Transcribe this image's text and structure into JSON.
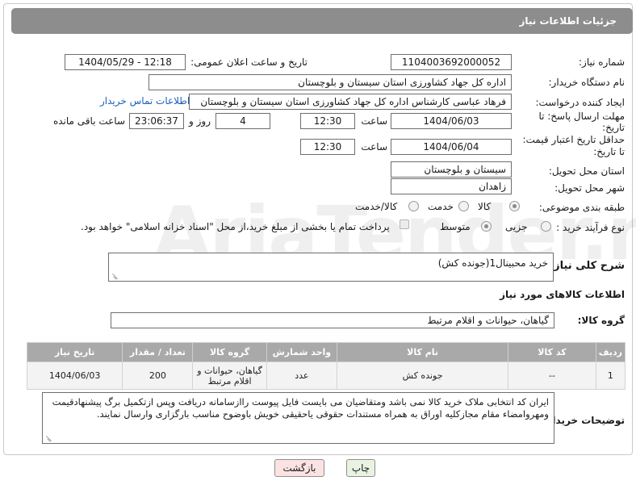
{
  "page": {
    "title": "جزئیات اطلاعات نیاز"
  },
  "fields": {
    "need_number": {
      "label": "شماره نیاز:",
      "value": "1104003692000052"
    },
    "announce_datetime": {
      "label": "تاریخ و ساعت اعلان عمومی:",
      "value": "1404/05/29 - 12:18"
    },
    "buyer_org": {
      "label": "نام دستگاه خریدار:",
      "value": "اداره کل جهاد کشاورزی استان سیستان و بلوچستان"
    },
    "requester": {
      "label": "ایجاد کننده درخواست:",
      "value": "فرهاد عباسی کارشناس  اداره کل جهاد کشاورزی استان سیستان و بلوچستان",
      "contact_link": "اطلاعات تماس خریدار"
    },
    "reply_deadline": {
      "label_line1": "مهلت ارسال پاسخ: تا",
      "label_line2": "تاریخ:",
      "date": "1404/06/03",
      "time_label": "ساعت",
      "time": "12:30",
      "days": "4",
      "days_label": "روز و",
      "remaining": "23:06:37",
      "remaining_label": "ساعت باقی مانده"
    },
    "price_validity": {
      "label_line1": "حداقل تاریخ اعتبار قیمت:",
      "label_line2": "تا تاریخ:",
      "date": "1404/06/04",
      "time_label": "ساعت",
      "time": "12:30"
    },
    "delivery_province": {
      "label": "استان محل تحویل:",
      "value": "سیستان و بلوچستان"
    },
    "delivery_city": {
      "label": "شهر محل تحویل:",
      "value": "زاهدان"
    },
    "category": {
      "label": "طبقه بندی موضوعی:",
      "options": [
        "کالا",
        "خدمت",
        "کالا/خدمت"
      ],
      "selected": "کالا"
    },
    "process_type": {
      "label": "نوع فرآیند خرید :",
      "options": [
        "جزیی",
        "متوسط"
      ],
      "selected": "متوسط",
      "checkbox_text": "پرداخت تمام یا بخشی از مبلغ خرید،از محل \"اسناد خزانه اسلامی\" خواهد بود."
    }
  },
  "summary": {
    "label": "شرح کلی نیاز:",
    "value": "خرید محبینال1(جونده کش)"
  },
  "goods_section": {
    "title": "اطلاعات کالاهای مورد نیاز"
  },
  "goods_group": {
    "label": "گروه کالا:",
    "value": "گیاهان، حیوانات و اقلام مرتبط"
  },
  "table": {
    "headers": [
      "ردیف",
      "کد کالا",
      "نام کالا",
      "واحد شمارش",
      "گروه کالا",
      "تعداد / مقدار",
      "تاریخ نیاز"
    ],
    "rows": [
      [
        "1",
        "--",
        "جونده کش",
        "عدد",
        "گیاهان، حیوانات و اقلام مرتبط",
        "200",
        "1404/06/03"
      ]
    ]
  },
  "buyer_notes": {
    "label": "توضیحات خریدار:",
    "value": "ایران کد انتخابی ملاک خرید کالا نمی باشد ومتقاضیان می بایست فایل پیوست راازسامانه دریافت وپس ازتکمیل برگ پیشنهادقیمت ومهروامضاء مقام مجازکلیه اوراق به همراه مستندات حقوقی یاحقیقی خویش باوضوح مناسب بارگزاری وارسال نمایند."
  },
  "buttons": {
    "print": "چاپ",
    "back": "بازگشت"
  },
  "colors": {
    "header_bg": "#8d8d8d",
    "table_header_bg": "#a9a9a9",
    "link": "#1d5fb8",
    "back_button_bg": "#fbe3e3",
    "print_button_bg": "#e9f3e2"
  },
  "watermark": {
    "text": "AriaTender.neT"
  }
}
